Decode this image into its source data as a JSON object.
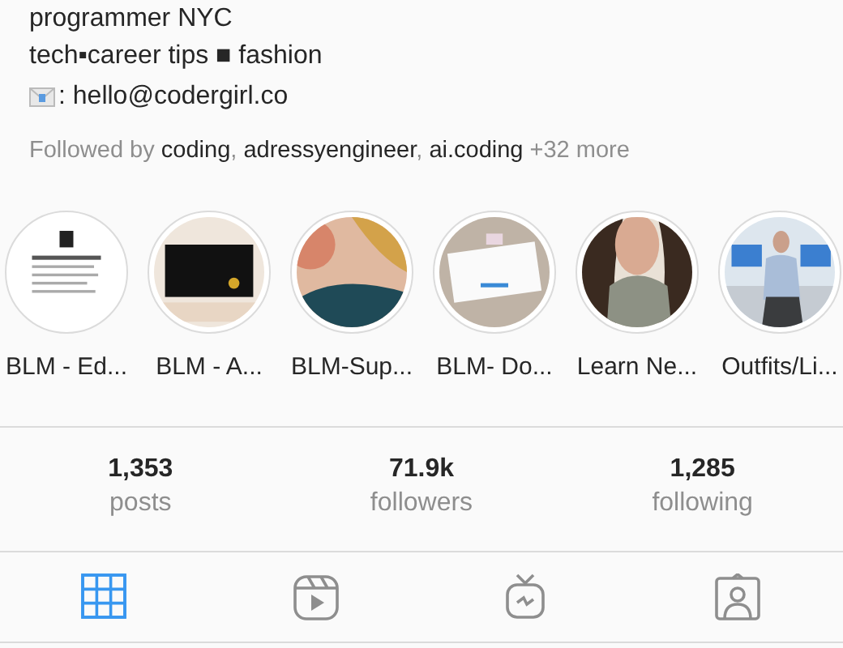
{
  "bio": {
    "lines": [
      "programmer NYC",
      "tech▪career tips ■ fashion"
    ],
    "email": ": hello@codergirl.co",
    "followed_by": "Followed by **coding**, **adressyengineer**, **ai.coding** +32 more"
  },
  "highlights": [
    {
      "label": "BLM - Ed...",
      "kind": "picture"
    },
    {
      "label": "BLM - A...",
      "kind": "picture"
    },
    {
      "label": "BLM-Sup...",
      "kind": "picture"
    },
    {
      "label": "BLM- Do...",
      "kind": "picture"
    },
    {
      "label": "Learn Ne...",
      "kind": "picture"
    },
    {
      "label": "Outfits/Li...",
      "kind": "picture"
    }
  ],
  "stats": [
    {
      "value": "1,353",
      "label": "posts"
    },
    {
      "value": "71.9k",
      "label": "followers"
    },
    {
      "value": "1,285",
      "label": "following"
    }
  ],
  "tabs": [
    {
      "kind": "grid",
      "selected": true
    },
    {
      "kind": "reels",
      "selected": false
    },
    {
      "kind": "tv",
      "selected": false
    },
    {
      "kind": "tagged",
      "selected": false
    }
  ]
}
